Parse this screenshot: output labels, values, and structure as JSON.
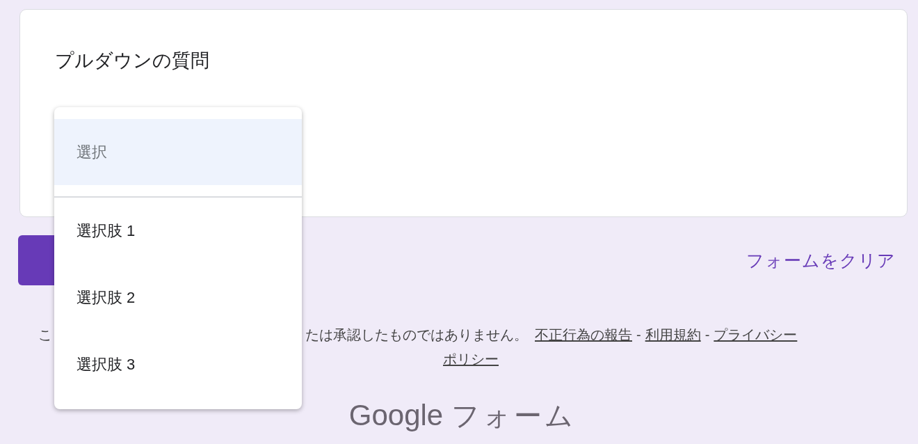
{
  "question": {
    "title": "プルダウンの質問"
  },
  "dropdown": {
    "options": [
      {
        "label": "選択",
        "kind": "placeholder",
        "selected": true
      },
      {
        "label": "選択肢 1",
        "kind": "option",
        "selected": false
      },
      {
        "label": "選択肢 2",
        "kind": "option",
        "selected": false
      },
      {
        "label": "選択肢 3",
        "kind": "option",
        "selected": false
      }
    ]
  },
  "clear_link": "フォームをクリア",
  "footer": {
    "notice_fragments": [
      "こ",
      "たは承認したものではありません。"
    ],
    "links": [
      {
        "label": "不正行為の報告"
      },
      {
        "label": "利用規約"
      },
      {
        "label": "プライバシー"
      }
    ],
    "separators": [
      "-",
      "-"
    ],
    "link_continuation": "ポリシー"
  },
  "logo": {
    "brand": "Google",
    "product": "フォーム"
  }
}
